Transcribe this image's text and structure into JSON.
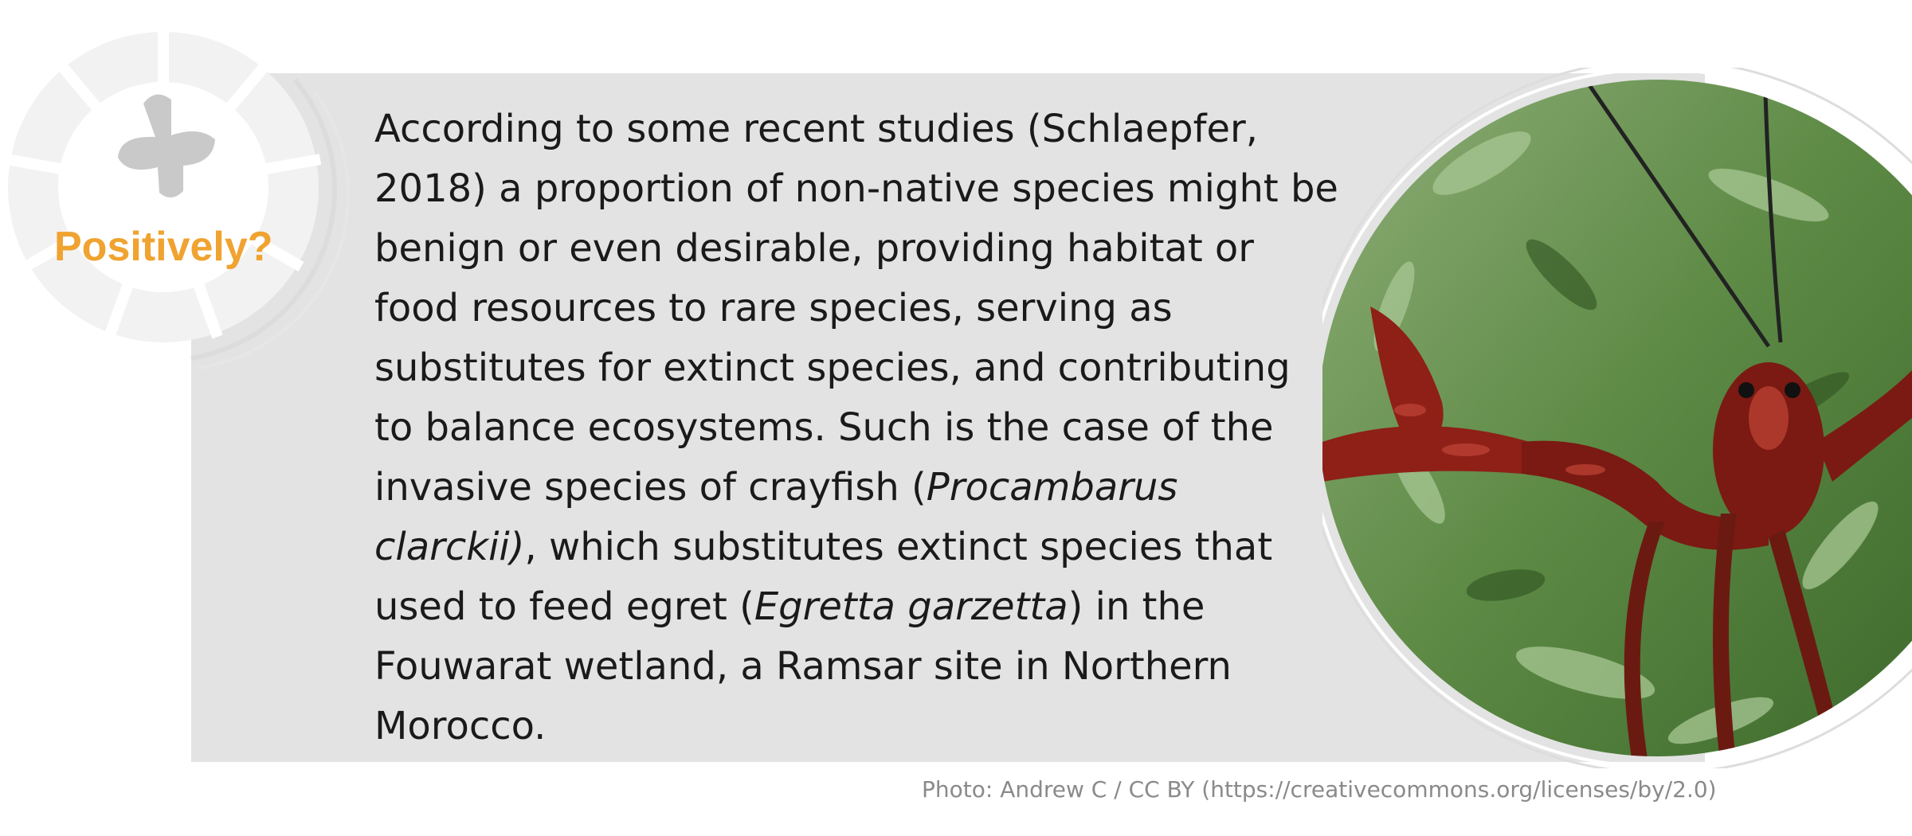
{
  "badge": {
    "label": "Positively?",
    "icon": "plus-icon",
    "label_color": "#f0a330"
  },
  "body": {
    "p1": "According to some recent studies (Schlaepfer, 2018) a proportion of non-native species might be benign or even desirable, providing habitat or food resources to rare species, serving as substitutes for extinct species, and contributing to balance ecosystems. Such is the case of the invasive species of crayfish (",
    "species1": "Procambarus clarckii)",
    "p2": ", which substitutes extinct species that used to feed egret (",
    "species2": "Egretta garzetta",
    "p3": ") in the Fouwarat wetland, a Ramsar site in Northern Morocco."
  },
  "photo": {
    "subject": "red crayfish on grass"
  },
  "caption": "Photo: Andrew C / CC BY (https://creativecommons.org/licenses/by/2.0)",
  "colors": {
    "panel": "#e3e3e3",
    "accent": "#f0a330",
    "text": "#1a1a1a",
    "caption": "#8a8a8a"
  }
}
